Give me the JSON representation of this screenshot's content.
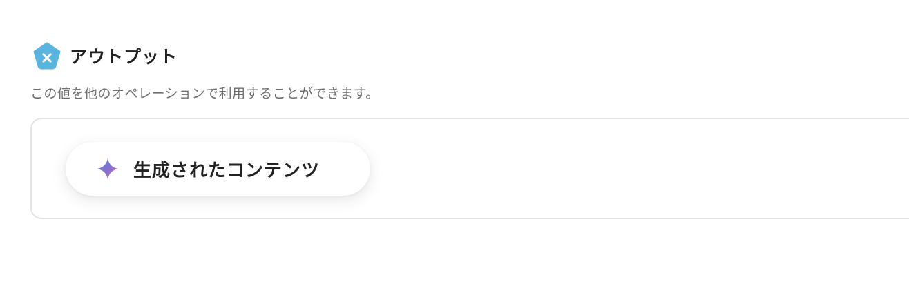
{
  "header": {
    "title": "アウトプット",
    "logo_icon": "pentagon-x-icon",
    "logo_color": "#5ab4e0"
  },
  "description": "この値を他のオペレーションで利用することができます。",
  "output": {
    "chip_label": "生成されたコンテンツ",
    "chip_icon": "sparkle-icon",
    "sparkle_colors": [
      "#4f7fdc",
      "#8a6fd0",
      "#d87aa0"
    ]
  }
}
